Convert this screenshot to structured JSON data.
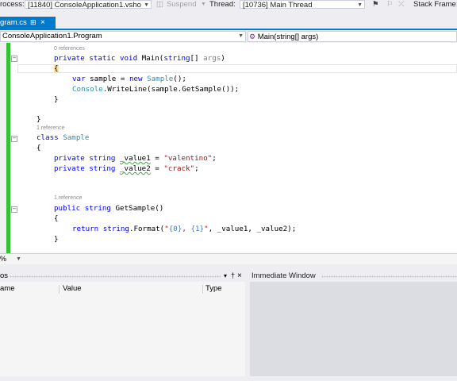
{
  "toolbar": {
    "process_label": "rocess:",
    "process_value": "[11840] ConsoleApplication1.vsho",
    "suspend_label": "Suspend",
    "thread_label": "Thread:",
    "thread_value": "[10736] Main Thread",
    "stack_frame_label": "Stack Frame:"
  },
  "tabs": {
    "active_label": "gram.cs",
    "pin_glyph": "⊞",
    "close_glyph": "×"
  },
  "navbar": {
    "class_combo": "ConsoleApplication1.Program",
    "member_combo": "Main(string[] args)"
  },
  "editor": {
    "refs": {
      "r0": "0 references",
      "r1": "1 reference",
      "r2": "1 reference"
    },
    "code": {
      "l_main_kw": "private static void",
      "l_main_name": " Main(",
      "l_main_kw2": "string",
      "l_main_rest": "[] ",
      "l_main_param": "args",
      "l_main_close": ")",
      "l_open1": "{",
      "l_var": "var",
      "l_sample": " sample = ",
      "l_new": "new",
      "l_Sample": "Sample",
      "l_ctor": "();",
      "l_Console": "Console",
      "l_writeline": ".WriteLine(sample.GetSample());",
      "l_close1": "}",
      "l_close2": "}",
      "l_class_kw": "class",
      "l_class_name": "Sample",
      "l_open3": "{",
      "l_f1_kw": "private string",
      "l_f1_name": "_value1",
      "l_f1_eq": " = ",
      "l_f1_val": "\"valentino\"",
      "l_f1_end": ";",
      "l_f2_kw": "private string",
      "l_f2_name": "_value2",
      "l_f2_eq": " = ",
      "l_f2_val": "\"crack\"",
      "l_f2_end": ";",
      "l_m_kw": "public string",
      "l_m_name": " GetSample()",
      "l_open4": "{",
      "l_ret": "return",
      "l_str": "string",
      "l_fmt": ".Format(",
      "l_fmt_q1": "\"",
      "l_fmt_p0": "{0}",
      "l_fmt_sep": ", ",
      "l_fmt_p1": "{1}",
      "l_fmt_q2": "\"",
      "l_fmt_rest": ", _value1, _value2);",
      "l_close4": "}"
    }
  },
  "zoom": {
    "value": "%"
  },
  "locals": {
    "title": "os",
    "col_name": "ame",
    "col_value": "Value",
    "col_type": "Type",
    "pin_glyph": "†",
    "close_glyph": "×",
    "dropdown_glyph": "▾"
  },
  "immediate": {
    "title": "Immediate Window"
  }
}
